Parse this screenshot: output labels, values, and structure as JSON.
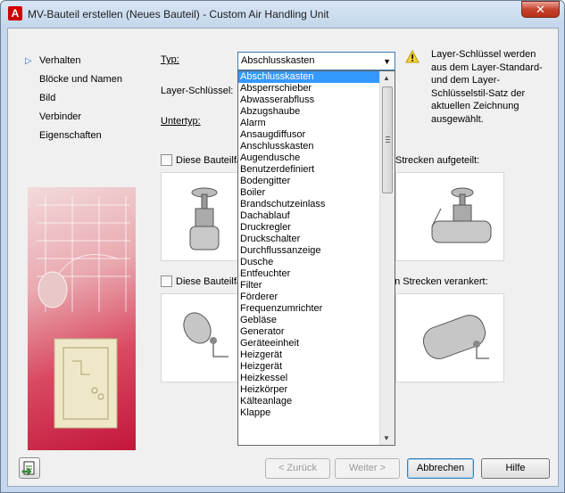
{
  "window": {
    "title": "MV-Bauteil erstellen (Neues Bauteil) - Custom Air Handling Unit",
    "close_label": "✕"
  },
  "nav": {
    "items": [
      {
        "label": "Verhalten",
        "active": true
      },
      {
        "label": "Blöcke und Namen",
        "active": false
      },
      {
        "label": "Bild",
        "active": false
      },
      {
        "label": "Verbinder",
        "active": false
      },
      {
        "label": "Eigenschaften",
        "active": false
      }
    ]
  },
  "form": {
    "typ_label": "Typ:",
    "typ_value": "Abschlusskasten",
    "layer_label": "Layer-Schlüssel:",
    "untertyp_label": "Untertyp:",
    "info_text": "Layer-Schlüssel werden aus dem Layer-Standard- und dem Layer-Schlüsselstil-Satz der aktuellen Zeichnung ausgewählt.",
    "checkbox1_left": "Diese Bauteilfa",
    "checkbox1_right": "Strecken aufgeteilt:",
    "checkbox2_left": "Diese Bauteilfa",
    "checkbox2_right": "en Strecken verankert:"
  },
  "dropdown": {
    "selected_index": 0,
    "options": [
      "Abschlusskasten",
      "Absperrschieber",
      "Abwasserabfluss",
      "Abzugshaube",
      "Alarm",
      "Ansaugdiffusor",
      "Anschlusskasten",
      "Augendusche",
      "Benutzerdefiniert",
      "Bodengitter",
      "Boiler",
      "Brandschutzeinlass",
      "Dachablauf",
      "Druckregler",
      "Druckschalter",
      "Durchflussanzeige",
      "Dusche",
      "Entfeuchter",
      "Filter",
      "Förderer",
      "Frequenzumrichter",
      "Gebläse",
      "Generator",
      "Geräteeinheit",
      "Heizgerät",
      "Heizgerät",
      "Heizkessel",
      "Heizkörper",
      "Kälteanlage",
      "Klappe"
    ]
  },
  "buttons": {
    "back": "< Zurück",
    "next": "Weiter >",
    "cancel": "Abbrechen",
    "help": "Hilfe"
  },
  "colors": {
    "selection": "#3399ff",
    "accent": "#2a6fc9"
  }
}
